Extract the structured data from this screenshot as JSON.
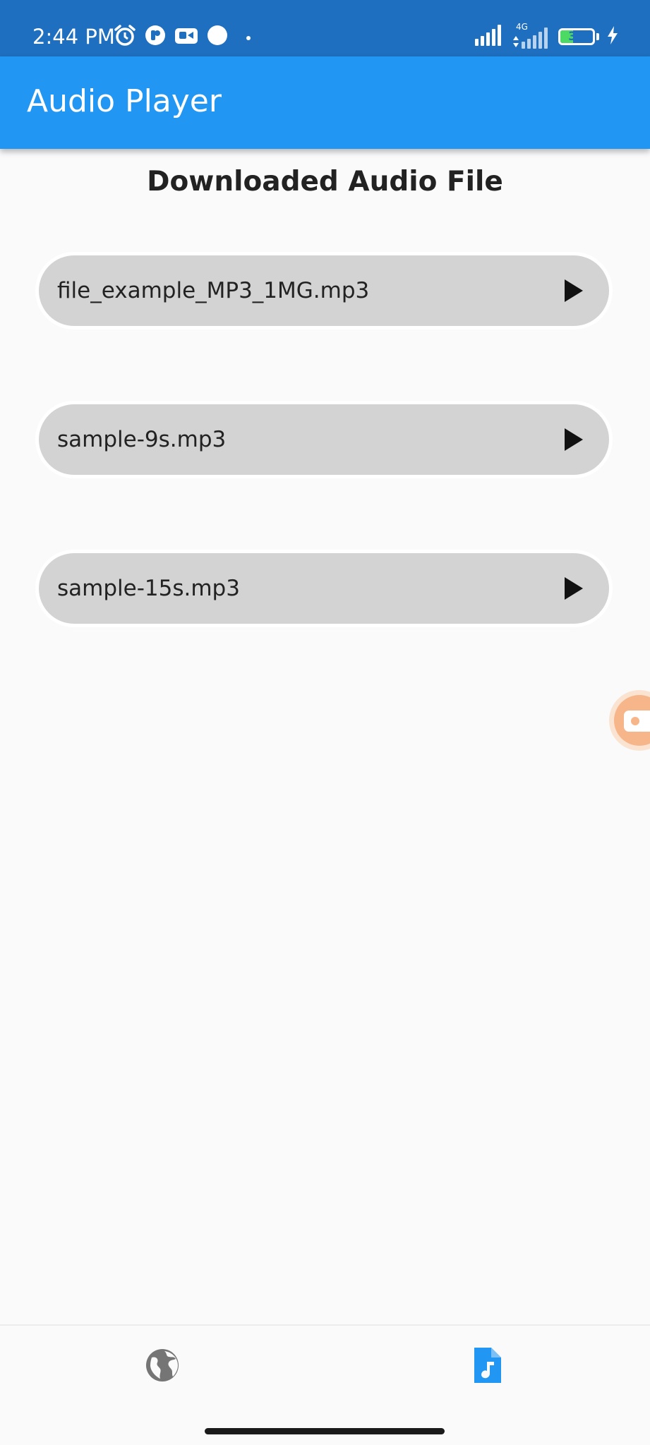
{
  "status_bar": {
    "time": "2:44 PM",
    "network": "4G",
    "battery_level": 39,
    "battery_text": "39",
    "icons_left": [
      "alarm-icon",
      "app-notification-icon",
      "screen-record-icon",
      "circle-notification-icon",
      "more-dot-icon"
    ],
    "icons_right": [
      "signal-icon",
      "signal-4g-icon",
      "battery-icon",
      "charging-icon"
    ]
  },
  "app_bar": {
    "title": "Audio Player",
    "color": "#2196f3"
  },
  "main": {
    "heading": "Downloaded Audio File",
    "files": [
      {
        "name": "file_example_MP3_1MG.mp3",
        "icon": "play-icon"
      },
      {
        "name": "sample-9s.mp3",
        "icon": "play-icon"
      },
      {
        "name": "sample-15s.mp3",
        "icon": "play-icon"
      }
    ]
  },
  "floating_bubble": {
    "icon": "screen-record-icon",
    "color": "#f7b58a"
  },
  "bottom_nav": {
    "items": [
      {
        "id": "web",
        "icon": "globe-icon",
        "active": false,
        "color": "#757575"
      },
      {
        "id": "audio",
        "icon": "music-file-icon",
        "active": true,
        "color": "#2196f3"
      }
    ]
  }
}
